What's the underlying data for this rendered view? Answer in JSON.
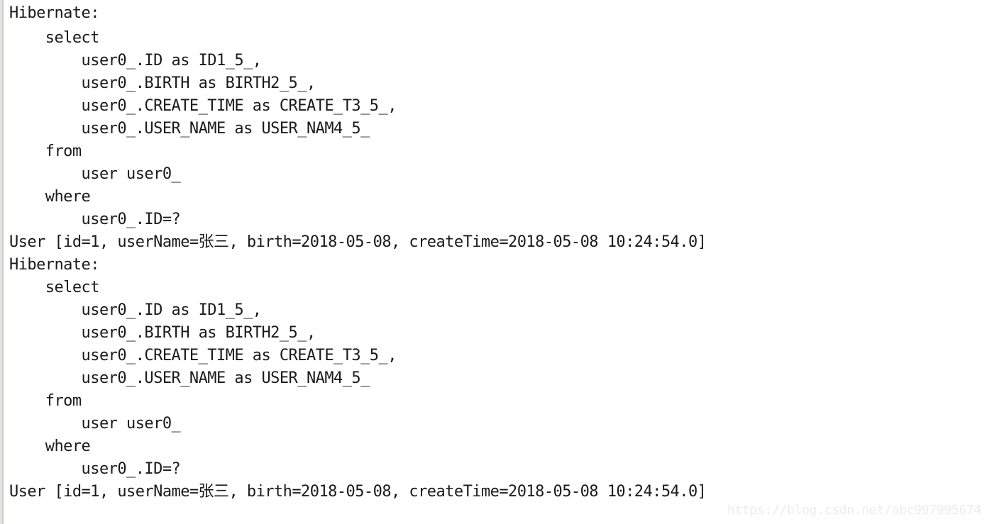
{
  "console": {
    "background_color": "#ffffff",
    "text_color": "#1a1a1a",
    "gutter_outer_color": "#e8e2d4",
    "gutter_inner_color": "#c2cdd9",
    "lines": [
      "Hibernate: ",
      "    select",
      "        user0_.ID as ID1_5_,",
      "        user0_.BIRTH as BIRTH2_5_,",
      "        user0_.CREATE_TIME as CREATE_T3_5_,",
      "        user0_.USER_NAME as USER_NAM4_5_",
      "    from",
      "        user user0_",
      "    where",
      "        user0_.ID=?",
      "User [id=1, userName=张三, birth=2018-05-08, createTime=2018-05-08 10:24:54.0]",
      "Hibernate: ",
      "    select",
      "        user0_.ID as ID1_5_,",
      "        user0_.BIRTH as BIRTH2_5_,",
      "        user0_.CREATE_TIME as CREATE_T3_5_,",
      "        user0_.USER_NAME as USER_NAM4_5_",
      "    from",
      "        user user0_",
      "    where",
      "        user0_.ID=?",
      "User [id=1, userName=张三, birth=2018-05-08, createTime=2018-05-08 10:24:54.0]"
    ]
  },
  "watermark": {
    "text": "https://blog.csdn.net/abc997995674",
    "color": "#ececec"
  }
}
